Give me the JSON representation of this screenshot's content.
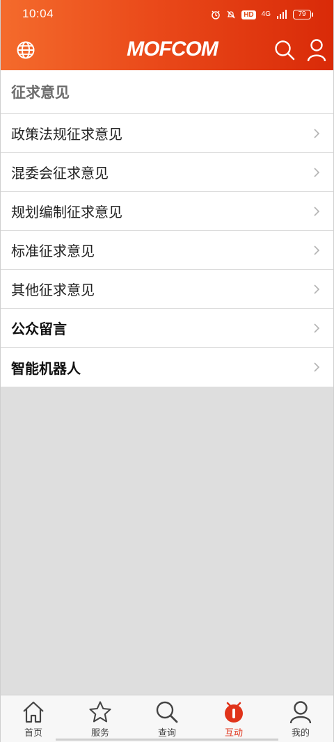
{
  "status": {
    "time": "10:04",
    "hd": "HD",
    "network": "4G",
    "battery": "79"
  },
  "header": {
    "logo_text": "MOFCOM"
  },
  "section": {
    "title": "征求意见"
  },
  "rows": [
    {
      "label": "政策法规征求意见",
      "bold": false
    },
    {
      "label": "混委会征求意见",
      "bold": false
    },
    {
      "label": "规划编制征求意见",
      "bold": false
    },
    {
      "label": "标准征求意见",
      "bold": false
    },
    {
      "label": "其他征求意见",
      "bold": false
    },
    {
      "label": "公众留言",
      "bold": true
    },
    {
      "label": "智能机器人",
      "bold": true
    }
  ],
  "tabs": [
    {
      "label": "首页",
      "icon": "home-icon"
    },
    {
      "label": "服务",
      "icon": "star-icon"
    },
    {
      "label": "查询",
      "icon": "search-icon"
    },
    {
      "label": "互动",
      "icon": "interact-icon",
      "active": true
    },
    {
      "label": "我的",
      "icon": "person-icon"
    }
  ],
  "colors": {
    "accent": "#e0331a",
    "header_start": "#f46b2c",
    "header_end": "#d92a08"
  }
}
